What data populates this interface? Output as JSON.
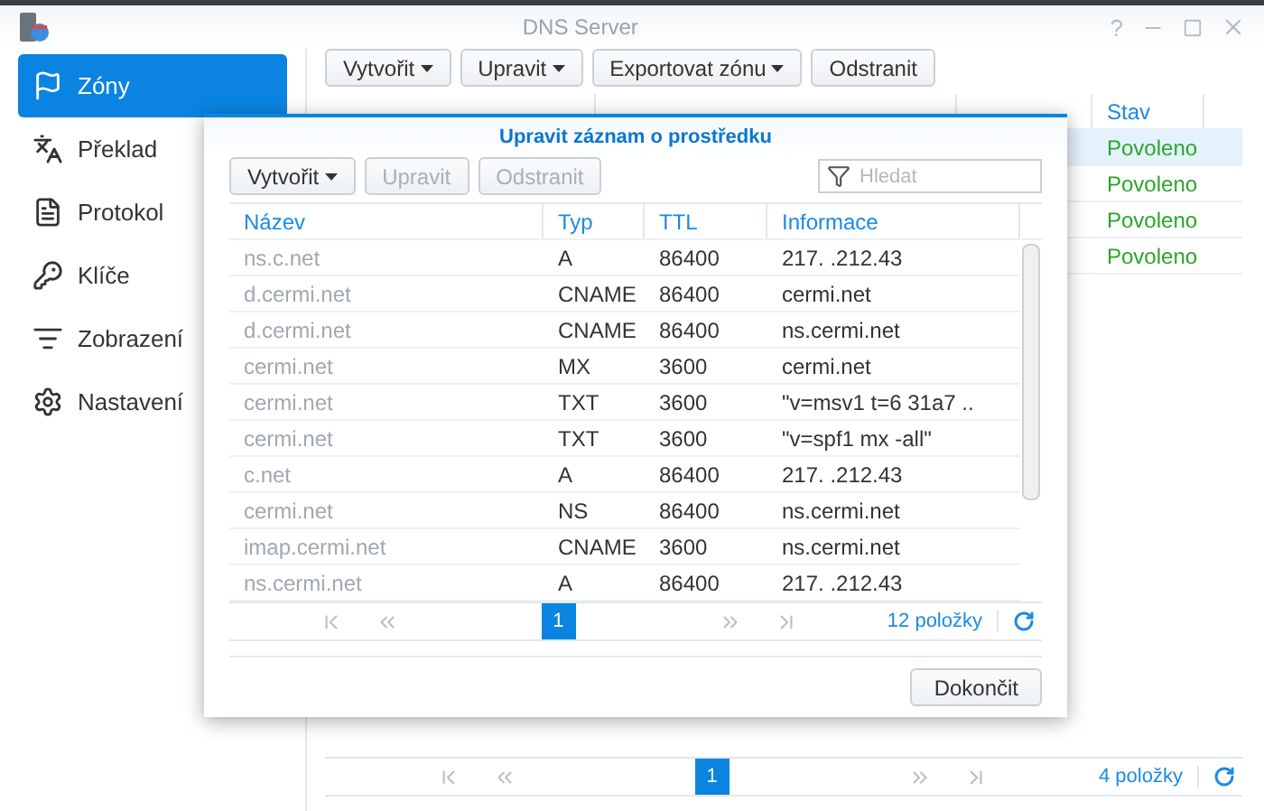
{
  "window": {
    "title": "DNS Server",
    "help": "?"
  },
  "sidebar": {
    "items": [
      {
        "label": "Zóny",
        "selected": true
      },
      {
        "label": "Překlad",
        "selected": false
      },
      {
        "label": "Protokol",
        "selected": false
      },
      {
        "label": "Klíče",
        "selected": false
      },
      {
        "label": "Zobrazení",
        "selected": false
      },
      {
        "label": "Nastavení",
        "selected": false
      }
    ]
  },
  "toolbar": [
    {
      "label": "Vytvořit",
      "dropdown": true,
      "disabled": false
    },
    {
      "label": "Upravit",
      "dropdown": true,
      "disabled": false
    },
    {
      "label": "Exportovat zónu",
      "dropdown": true,
      "disabled": false
    },
    {
      "label": "Odstranit",
      "dropdown": false,
      "disabled": false
    }
  ],
  "zones_table": {
    "columns": [
      "Stav"
    ],
    "rows": [
      {
        "status": "Povoleno",
        "selected": true
      },
      {
        "status": "Povoleno",
        "selected": false
      },
      {
        "status": "Povoleno",
        "selected": false
      },
      {
        "status": "Povoleno",
        "selected": false
      }
    ]
  },
  "pager": {
    "page": "1",
    "count": "4 položky"
  },
  "dialog": {
    "title": "Upravit záznam o prostředku",
    "toolbar": [
      {
        "label": "Vytvořit",
        "dropdown": true,
        "disabled": false
      },
      {
        "label": "Upravit",
        "dropdown": false,
        "disabled": true
      },
      {
        "label": "Odstranit",
        "dropdown": false,
        "disabled": true
      }
    ],
    "search": {
      "placeholder": "Hledat"
    },
    "columns": [
      "Název",
      "Typ",
      "TTL",
      "Informace"
    ],
    "rows": [
      {
        "name": "ns.c.net",
        "type": "A",
        "ttl": "86400",
        "info": "217.   .212.43"
      },
      {
        "name": "d.cermi.net",
        "type": "CNAME",
        "ttl": "86400",
        "info": "cermi.net"
      },
      {
        "name": "d.cermi.net",
        "type": "CNAME",
        "ttl": "86400",
        "info": "ns.cermi.net"
      },
      {
        "name": "cermi.net",
        "type": "MX",
        "ttl": "3600",
        "info": "cermi.net"
      },
      {
        "name": "cermi.net",
        "type": "TXT",
        "ttl": "3600",
        "info": "\"v=msv1 t=6   31a7 .."
      },
      {
        "name": "cermi.net",
        "type": "TXT",
        "ttl": "3600",
        "info": "\"v=spf1 mx -all\""
      },
      {
        "name": "c.net",
        "type": "A",
        "ttl": "86400",
        "info": "217.   .212.43"
      },
      {
        "name": "cermi.net",
        "type": "NS",
        "ttl": "86400",
        "info": "ns.cermi.net"
      },
      {
        "name": "imap.cermi.net",
        "type": "CNAME",
        "ttl": "3600",
        "info": "ns.cermi.net"
      },
      {
        "name": "ns.cermi.net",
        "type": "A",
        "ttl": "86400",
        "info": "217.   .212.43"
      }
    ],
    "pager": {
      "page": "1",
      "count": "12 položky"
    },
    "done": "Dokončit"
  }
}
